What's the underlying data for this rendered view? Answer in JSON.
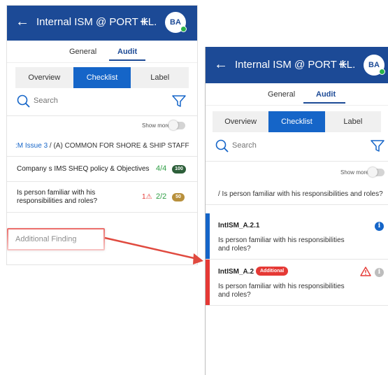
{
  "app": {
    "title": "Internal ISM @ PORT KL.",
    "avatar_initials": "BA",
    "brand_color": "#1c4a96"
  },
  "tabs": [
    {
      "label": "General"
    },
    {
      "label": "Audit"
    }
  ],
  "segments": [
    {
      "label": "Overview"
    },
    {
      "label": "Checklist"
    },
    {
      "label": "Label"
    }
  ],
  "search": {
    "placeholder": "Search"
  },
  "show_more": {
    "label": "Show more"
  },
  "left": {
    "breadcrumb_prefix": ":M Issue 3",
    "breadcrumb_rest": " / (A) COMMON FOR SHORE & SHIP STAFF",
    "rows": [
      {
        "text": "Company s IMS SHEQ policy & Objectives",
        "ratio": "4/4",
        "count": "100"
      },
      {
        "text": "Is person familiar with his responsibilities and roles?",
        "warn_count": "1",
        "ratio": "2/2",
        "count": "50"
      }
    ],
    "popup_label": "Additional Finding"
  },
  "right": {
    "breadcrumb": "/  Is person familiar with his responsibilities and roles?",
    "cards": [
      {
        "code": "IntISM_A.2.1",
        "text": "Is person familiar with his responsibilities and roles?",
        "bar_color": "#1565c8",
        "icon": "info-icon"
      },
      {
        "code": "IntISM_A.2",
        "badge": "Additional",
        "text": "Is person familiar with his responsibilities and roles?",
        "bar_color": "#e53935",
        "icon": "warning-icon"
      }
    ]
  },
  "colors": {
    "accent": "#1565c8",
    "success": "#2e9e44",
    "danger": "#e53935",
    "pill_dark": "#2d5f3a",
    "pill_tan": "#b8903c"
  }
}
